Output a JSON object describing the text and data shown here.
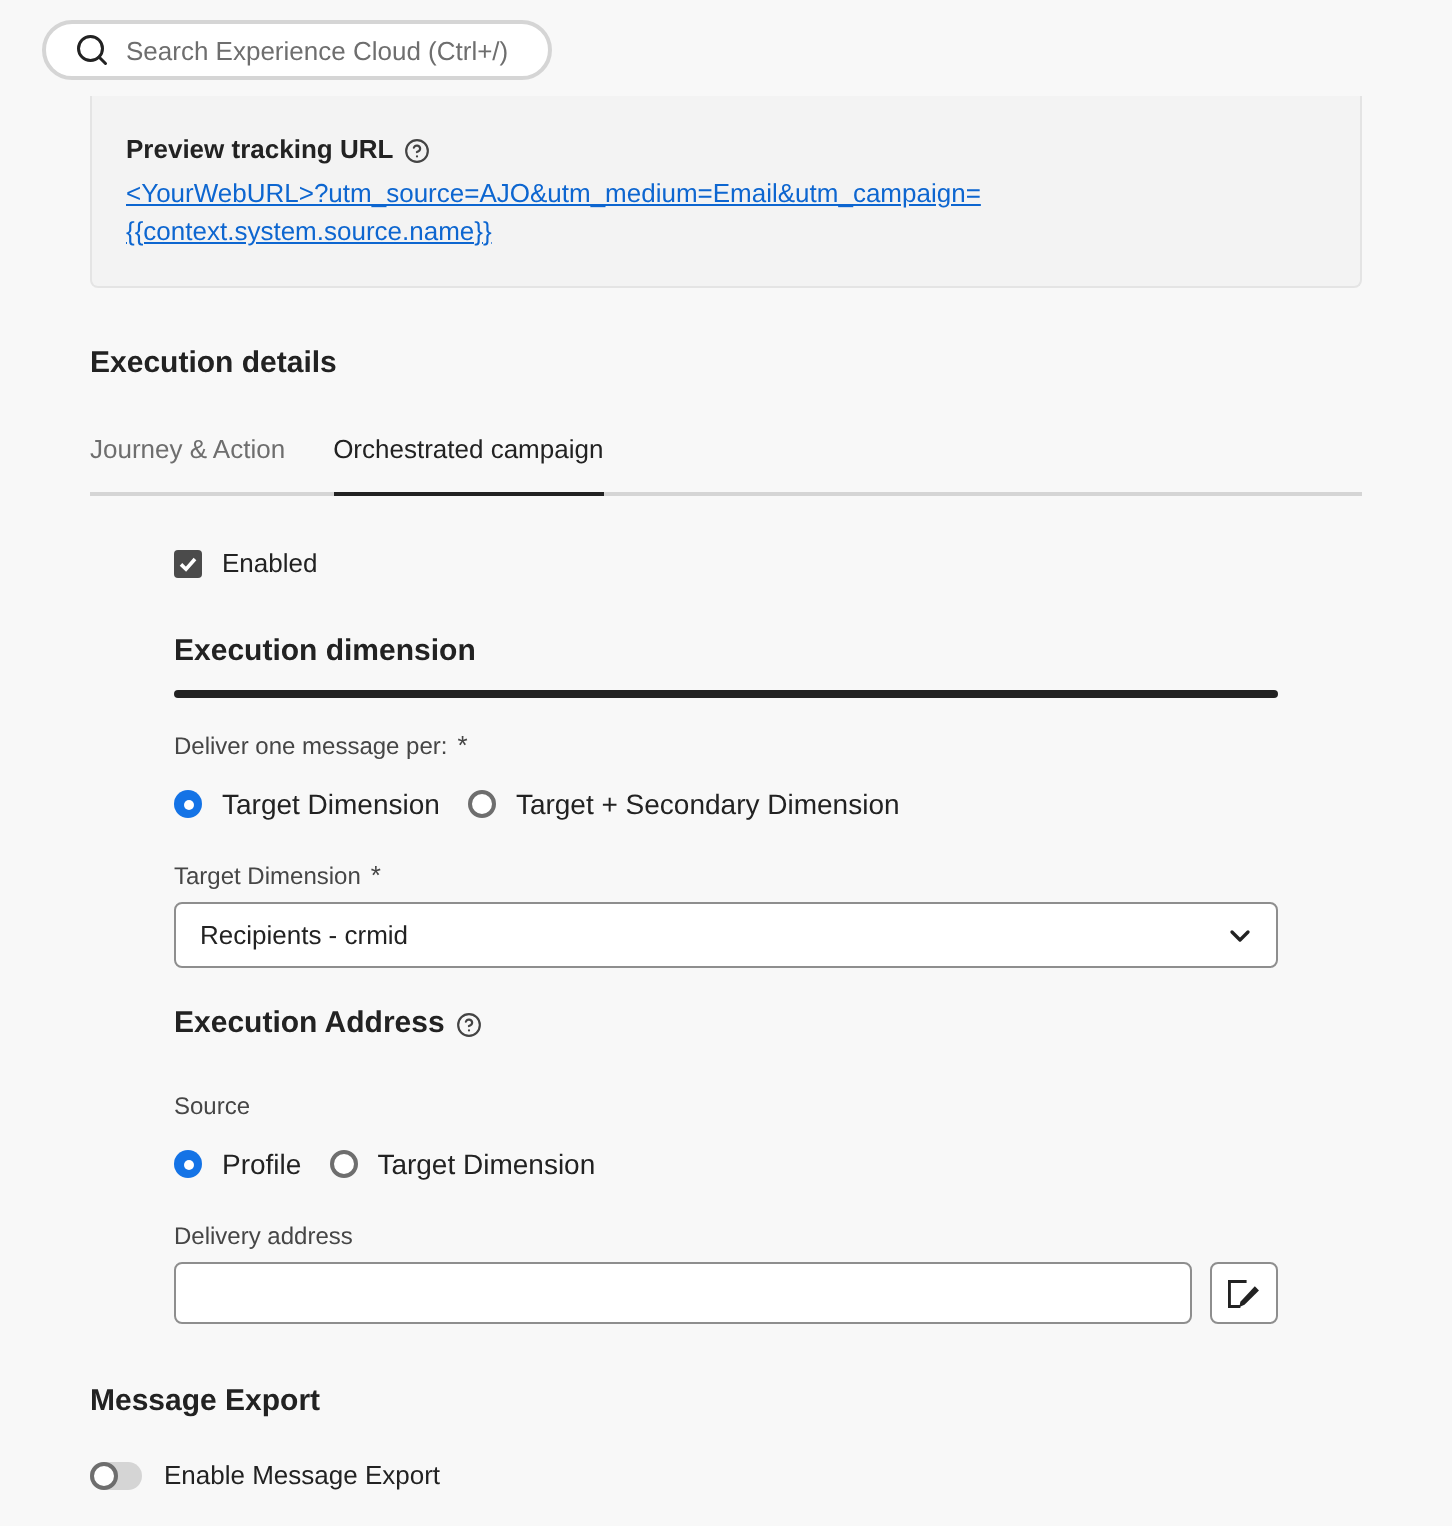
{
  "search": {
    "placeholder": "Search Experience Cloud (Ctrl+/)"
  },
  "preview": {
    "title": "Preview tracking URL",
    "link_lines": [
      "<YourWebURL>?utm_source=AJO&utm_medium=Email&utm_campaign=",
      "{{context.system.source.name}}"
    ]
  },
  "execution_details": {
    "title": "Execution details",
    "tabs": [
      {
        "label": "Journey & Action",
        "selected": false
      },
      {
        "label": "Orchestrated campaign",
        "selected": true
      }
    ]
  },
  "enabled": {
    "label": "Enabled",
    "checked": true
  },
  "execution_dimension": {
    "title": "Execution dimension",
    "deliver_label": "Deliver one message per:",
    "deliver_required_mark": "*",
    "deliver_options": [
      {
        "label": "Target Dimension",
        "selected": true
      },
      {
        "label": "Target + Secondary Dimension",
        "selected": false
      }
    ],
    "target_label": "Target Dimension",
    "target_required_mark": "*",
    "target_value": "Recipients - crmid"
  },
  "execution_address": {
    "title": "Execution Address",
    "source_label": "Source",
    "source_options": [
      {
        "label": "Profile",
        "selected": true
      },
      {
        "label": "Target Dimension",
        "selected": false
      }
    ],
    "delivery_label": "Delivery address"
  },
  "message_export": {
    "title": "Message Export",
    "toggle": {
      "label": "Enable Message Export",
      "on": false
    }
  }
}
